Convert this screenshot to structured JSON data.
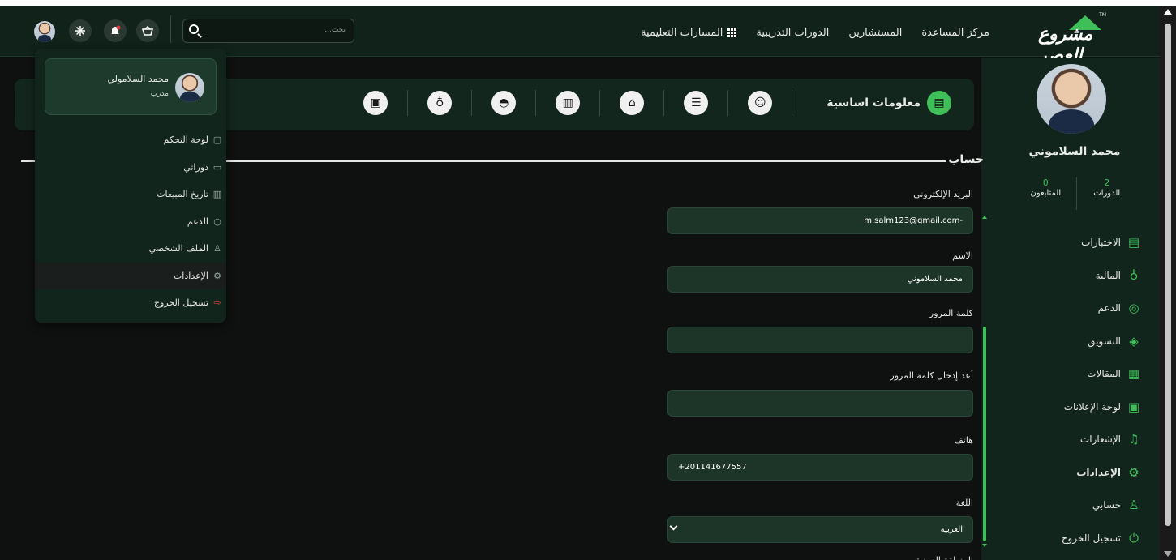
{
  "header": {
    "logo_text": "مشروع العصر",
    "logo_tm": "TM",
    "nav": [
      "المسارات التعليمية",
      "الدورات التدريبية",
      "المستشارين",
      "مركز المساعدة"
    ],
    "search_placeholder": "بحث..."
  },
  "icons": {
    "basket": "basket-icon",
    "bell": "bell-icon",
    "snowflake": "snowflake-icon"
  },
  "dropdown": {
    "name": "محمد السلامولي",
    "role": "مدرب",
    "items": [
      "لوحة التحكم",
      "دوراتي",
      "تاريخ المبيعات",
      "الدعم",
      "الملف الشخصي",
      "الإعدادات",
      "تسجيل الخروج"
    ]
  },
  "tabs": {
    "active": "معلومات اساسية"
  },
  "section": {
    "title": "حساب"
  },
  "form": {
    "email_label": "البريد الإلكتروني",
    "email_value": "m.salm123@gmail.com-",
    "name_label": "الاسم",
    "name_value": "محمد السلاموني",
    "password_label": "كلمة المرور",
    "password_value": "",
    "confirm_label": "أعد إدخال كلمة المرور",
    "confirm_value": "",
    "phone_label": "هاتف",
    "phone_value": "+201141677557",
    "language_label": "اللغة",
    "language_value": "العربية",
    "timezone_label": "المنطقة الزمنية"
  },
  "sidebar": {
    "name": "محمد السلاموني",
    "stats": [
      {
        "value": "2",
        "label": "الدورات"
      },
      {
        "value": "0",
        "label": "المتابعون"
      }
    ],
    "menu": [
      "الاختبارات",
      "المالية",
      "الدعم",
      "التسويق",
      "المقالات",
      "لوحة الإعلانات",
      "الإشعارات",
      "الإعدادات",
      "حسابي",
      "تسجيل الخروج"
    ]
  },
  "colors": {
    "accent": "#3fbf5a",
    "header_bg": "#10221a",
    "panel_bg": "#12251c",
    "input_bg": "#1d3429",
    "logout_red": "#e14040"
  }
}
